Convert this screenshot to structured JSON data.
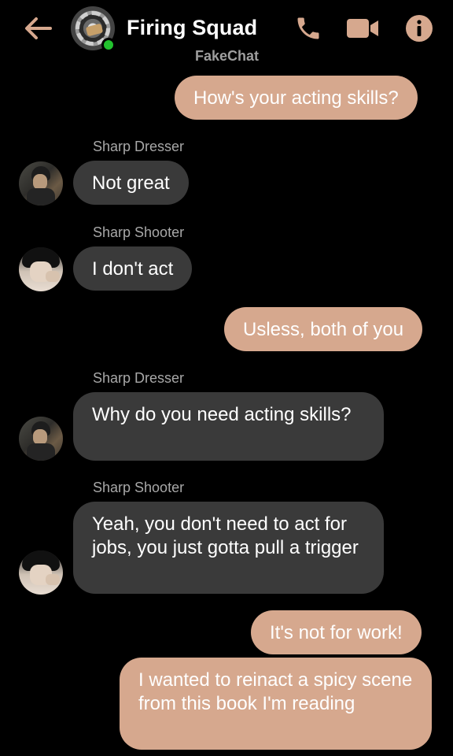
{
  "header": {
    "back_icon": "arrow-left-icon",
    "title": "Firing Squad",
    "subtitle": "FakeChat",
    "phone_icon": "phone-icon",
    "video_icon": "video-camera-icon",
    "info_icon": "info-icon",
    "accent_color": "#d6a88e",
    "online_color": "#22c22e"
  },
  "messages": [
    {
      "from": "me",
      "text": "How's your acting skills?"
    },
    {
      "from": "Sharp Dresser",
      "sender_label": "Sharp Dresser",
      "text": "Not great"
    },
    {
      "from": "Sharp Shooter",
      "sender_label": "Sharp Shooter",
      "text": "I don't act"
    },
    {
      "from": "me",
      "text": "Usless, both of you"
    },
    {
      "from": "Sharp Dresser",
      "sender_label": "Sharp Dresser",
      "text": "Why do you need acting skills?"
    },
    {
      "from": "Sharp Shooter",
      "sender_label": "Sharp Shooter",
      "text": "Yeah, you don't need to act for jobs, you just gotta pull a trigger"
    },
    {
      "from": "me",
      "text": "It's not for work!"
    },
    {
      "from": "me",
      "text": "I wanted to reinact a spicy scene from this book I'm reading"
    }
  ],
  "colors": {
    "outgoing_bubble": "#d6a88e",
    "incoming_bubble": "#3a3a3a",
    "background": "#000000"
  }
}
